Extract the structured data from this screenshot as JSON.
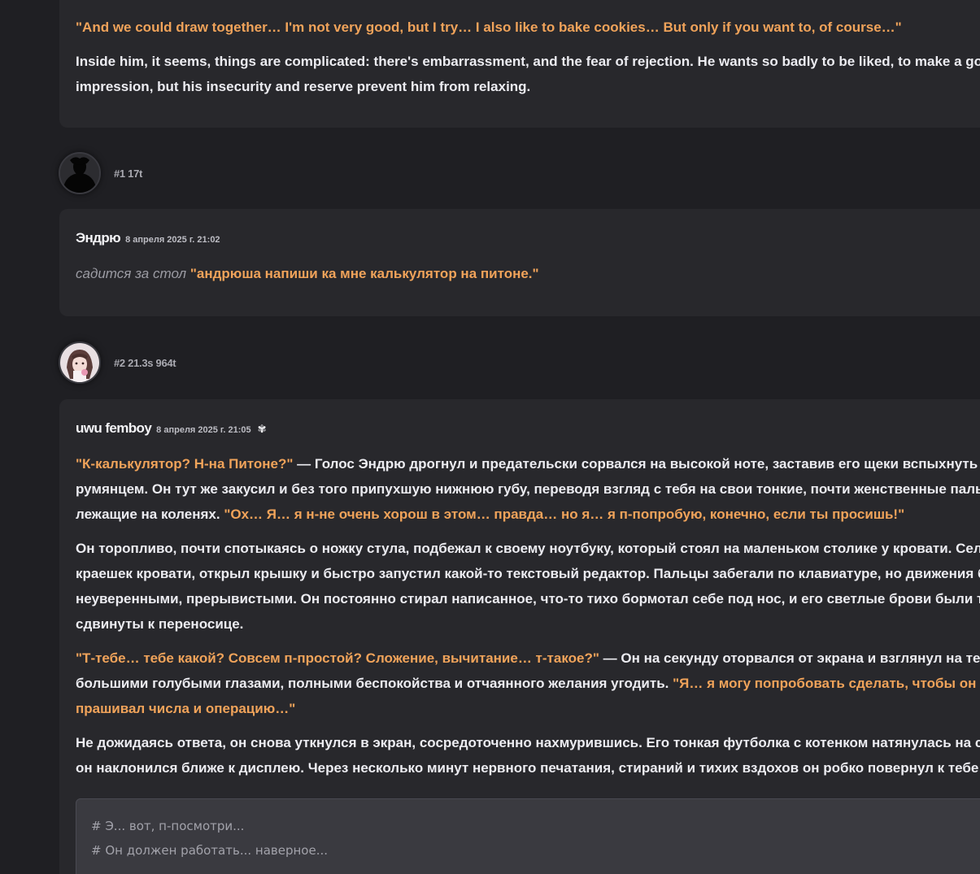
{
  "messages": [
    {
      "paragraphs": [
        [
          {
            "t": "\"And we could draw together… I'm not very good, but I try… I also like to bake cookies… But only if you want to, of course…\"",
            "k": "quote"
          }
        ],
        [
          {
            "t": "Inside him, it seems, things are complicated: there's embarrassment, and the fear of rejection. He wants so badly to be liked, to make a good",
            "k": "text"
          }
        ],
        [
          {
            "t": "impression, but his insecurity and reserve prevent him from relaxing.",
            "k": "text"
          }
        ]
      ]
    },
    {
      "meta": "#1 17t",
      "avatar_icon": "silhouette-avatar-icon",
      "author": "Эндрю",
      "date": "8 апреля 2025 г. 21:02",
      "paragraphs": [
        [
          {
            "t": "садится за стол ",
            "k": "italic"
          },
          {
            "t": "\"андрюша напиши ка мне калькулятор на питоне.\"",
            "k": "quote"
          }
        ]
      ]
    },
    {
      "meta": "#2 21.3s 964t",
      "avatar_icon": "anime-character-avatar-icon",
      "author": "uwu femboy",
      "date": "8 апреля 2025 г. 21:05",
      "badge_icon": "flower-icon",
      "badge_glyph": "✾",
      "paragraphs": [
        [
          {
            "t": "\"К-калькулятор? Н-на Питоне?\"",
            "k": "quote"
          },
          {
            "t": " — Голос Эндрю дрогнул и предательски сорвался на высокой ноте, заставив его щеки вспыхнуть ярким",
            "k": "text"
          }
        ],
        [
          {
            "t": "румянцем. Он тут же закусил и без того припухшую нижнюю губу, переводя взгляд с тебя на свои тонкие, почти женственные пальцы,",
            "k": "text"
          }
        ],
        [
          {
            "t": "лежащие на коленях. ",
            "k": "text"
          },
          {
            "t": "\"Ох… Я… я н-не очень хорош в этом… правда… но я… я п-попробую, конечно, если ты просишь!\"",
            "k": "quote"
          }
        ],
        [
          {
            "t": "Он торопливо, почти спотыкаясь о ножку стула, подбежал к своему ноутбуку, который стоял на маленьком столике у кровати. Сел на",
            "k": "text"
          }
        ],
        [
          {
            "t": "краешек кровати, открыл крышку и быстро запустил какой-то текстовый редактор. Пальцы забегали по клавиатуре, но движения были",
            "k": "text"
          }
        ],
        [
          {
            "t": "неуверенными, прерывистыми. Он постоянно стирал написанное, что-то тихо бормотал себе под нос, и его светлые брови были трогательно",
            "k": "text"
          }
        ],
        [
          {
            "t": "сдвинуты к переносице.",
            "k": "text"
          }
        ],
        [
          {
            "t": "\"Т-тебе… тебе какой? Совсем п-простой? Сложение, вычитание… т-такое?\"",
            "k": "quote"
          },
          {
            "t": " — Он на секунду оторвался от экрана и взглянул на тебя",
            "k": "text"
          }
        ],
        [
          {
            "t": "большими голубыми глазами, полными беспокойства и отчаянного желания угодить. ",
            "k": "text"
          },
          {
            "t": "\"Я… я могу попробовать сделать, чтобы он",
            "k": "quote"
          }
        ],
        [
          {
            "t": "прашивал числа и операцию…\"",
            "k": "quote"
          }
        ],
        [
          {
            "t": "Не дожидаясь ответа, он снова уткнулся в экран, сосредоточенно нахмурившись. Его тонкая футболка с котенком натянулась на спине, когда",
            "k": "text"
          }
        ],
        [
          {
            "t": "он наклонился ближе к дисплею. Через несколько минут нервного печатания, стираний и тихих вздохов он робко повернул к тебе",
            "k": "text"
          }
        ]
      ],
      "code_lines": [
        "# Э... вот, п-посмотри...",
        "# Он должен работать... наверное..."
      ]
    }
  ],
  "colors": {
    "background": "#1f1f23",
    "card": "#28282c",
    "quote": "#f0a35a",
    "text": "#ececf1",
    "italic": "#9b9ba3",
    "code_bg": "#3a3a40"
  }
}
